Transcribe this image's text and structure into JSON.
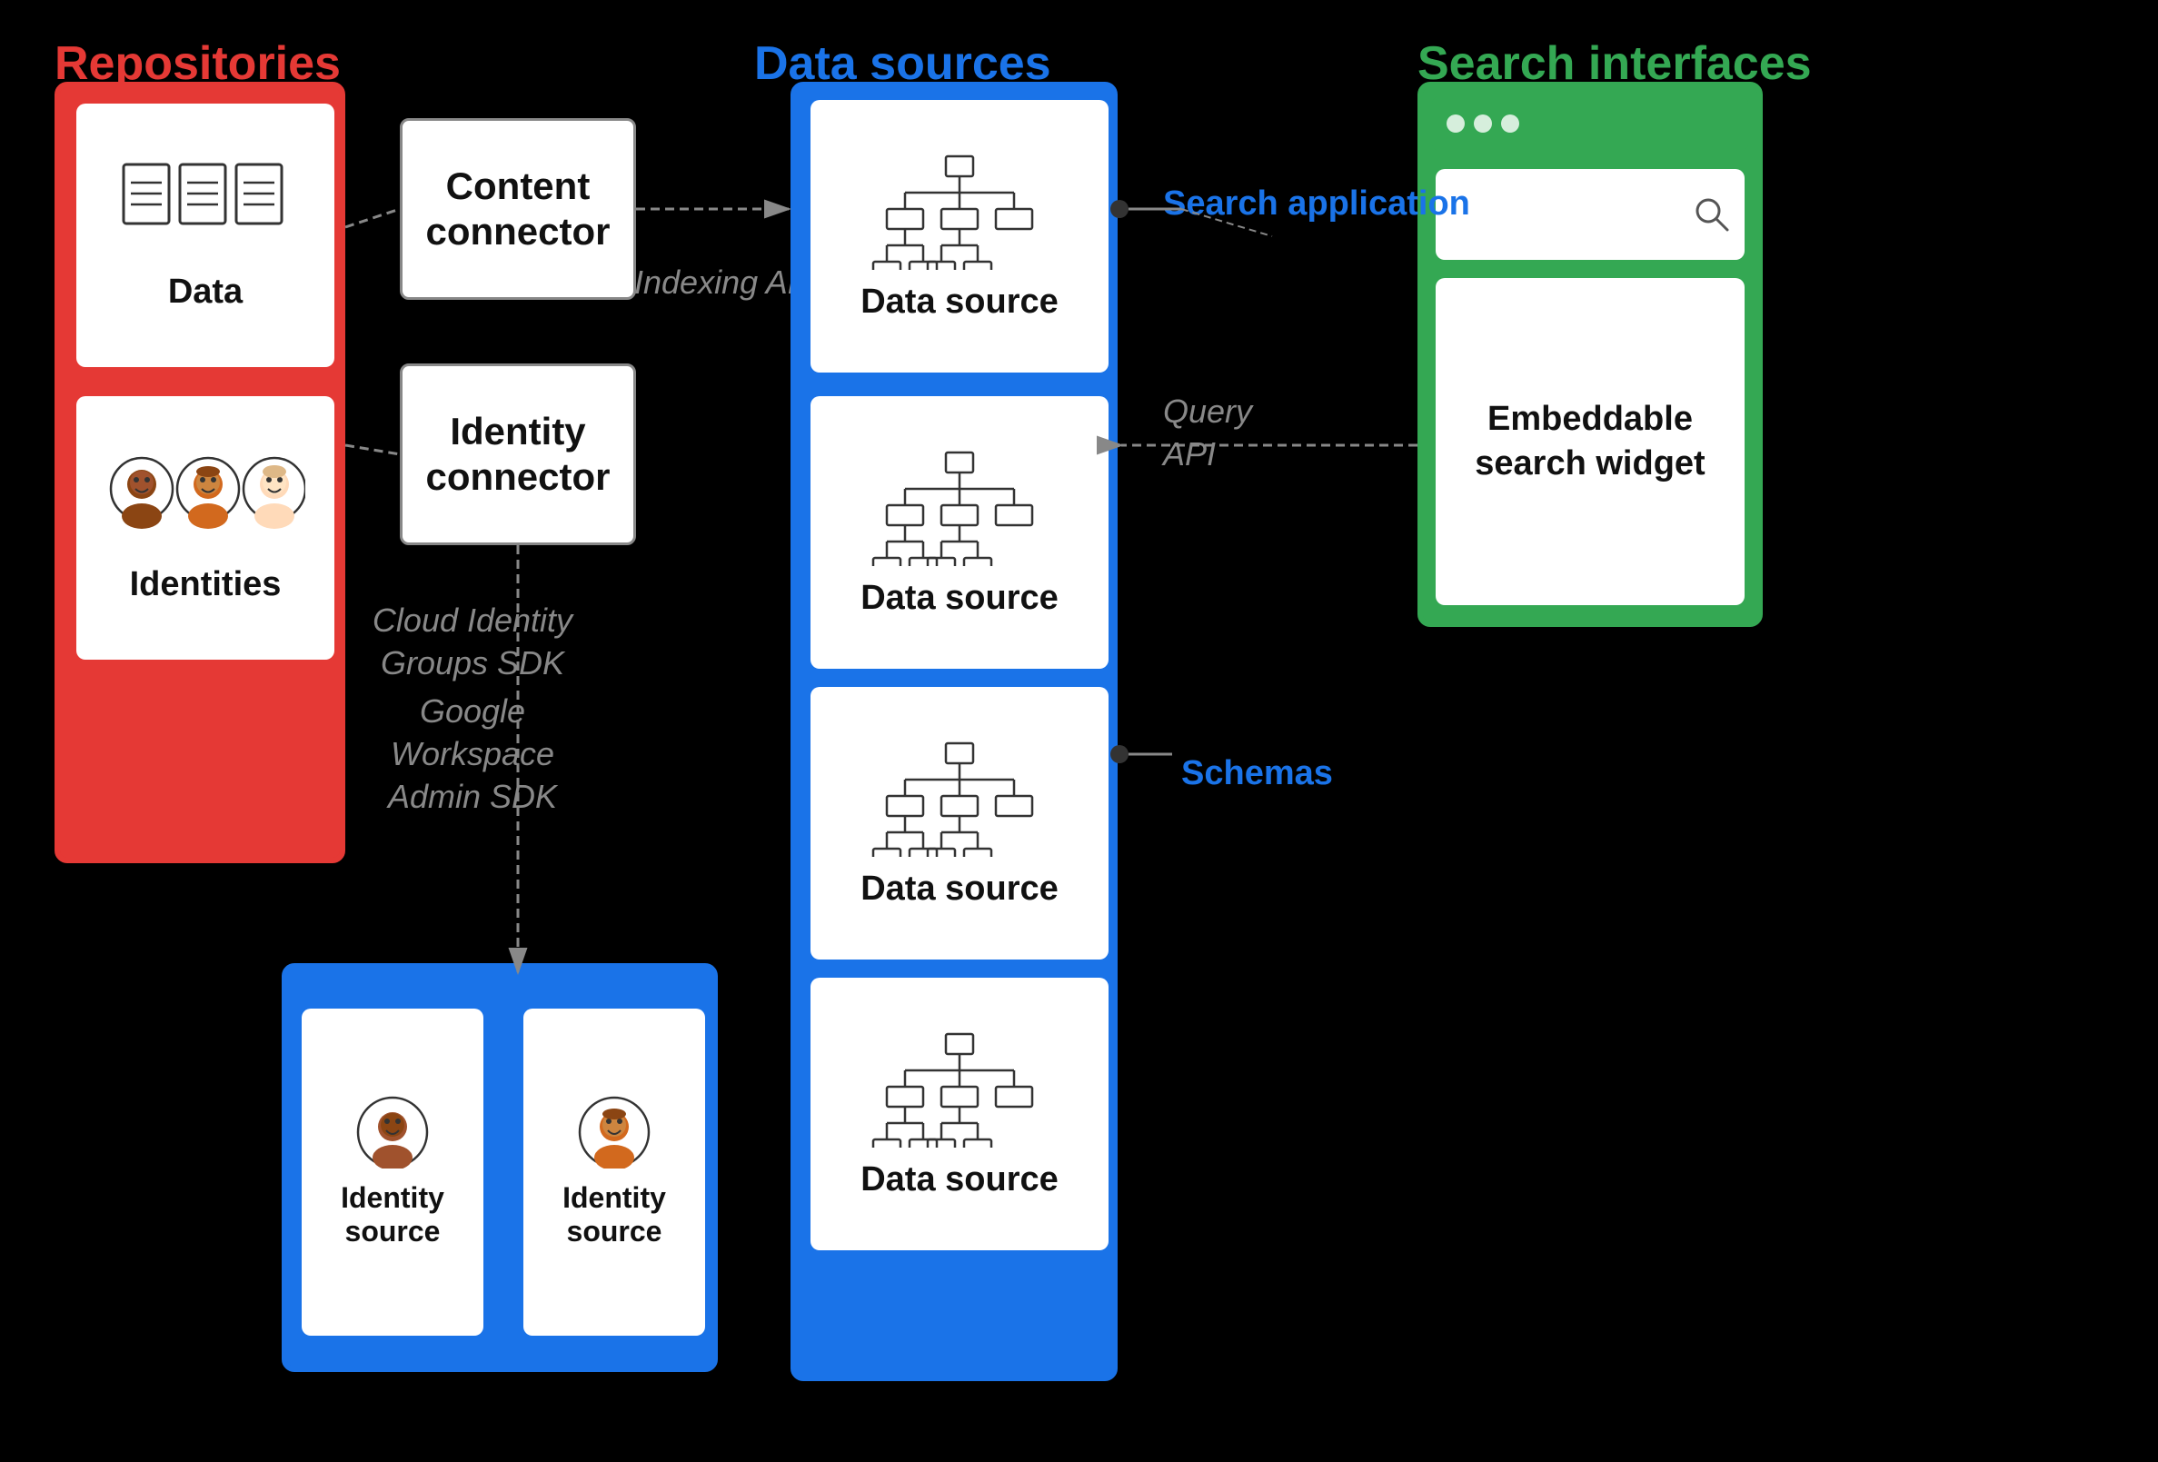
{
  "titles": {
    "repositories": "Repositories",
    "data_sources": "Data sources",
    "search_interfaces": "Search interfaces"
  },
  "repository_cards": {
    "data_label": "Data",
    "identities_label": "Identities"
  },
  "connectors": {
    "content_connector": "Content connector",
    "identity_connector": "Identity connector"
  },
  "api_labels": {
    "indexing_api": "Indexing API",
    "cloud_identity": "Cloud Identity\nGroups SDK",
    "google_workspace": "Google Workspace\nAdmin SDK",
    "query_api": "Query\nAPI"
  },
  "data_sources": {
    "label": "Data source"
  },
  "identity_sources": {
    "label": "Identity source",
    "label2": "Identity source"
  },
  "search_app_label": "Search\napplication",
  "schemas_label": "Schemas",
  "search_interface": {
    "search_label": "Search",
    "embeddable_label": "Embeddable\nsearch\nwidget"
  },
  "colors": {
    "red": "#e53935",
    "blue": "#1a73e8",
    "green": "#34a853",
    "gray": "#888888",
    "black": "#000000",
    "white": "#ffffff"
  }
}
